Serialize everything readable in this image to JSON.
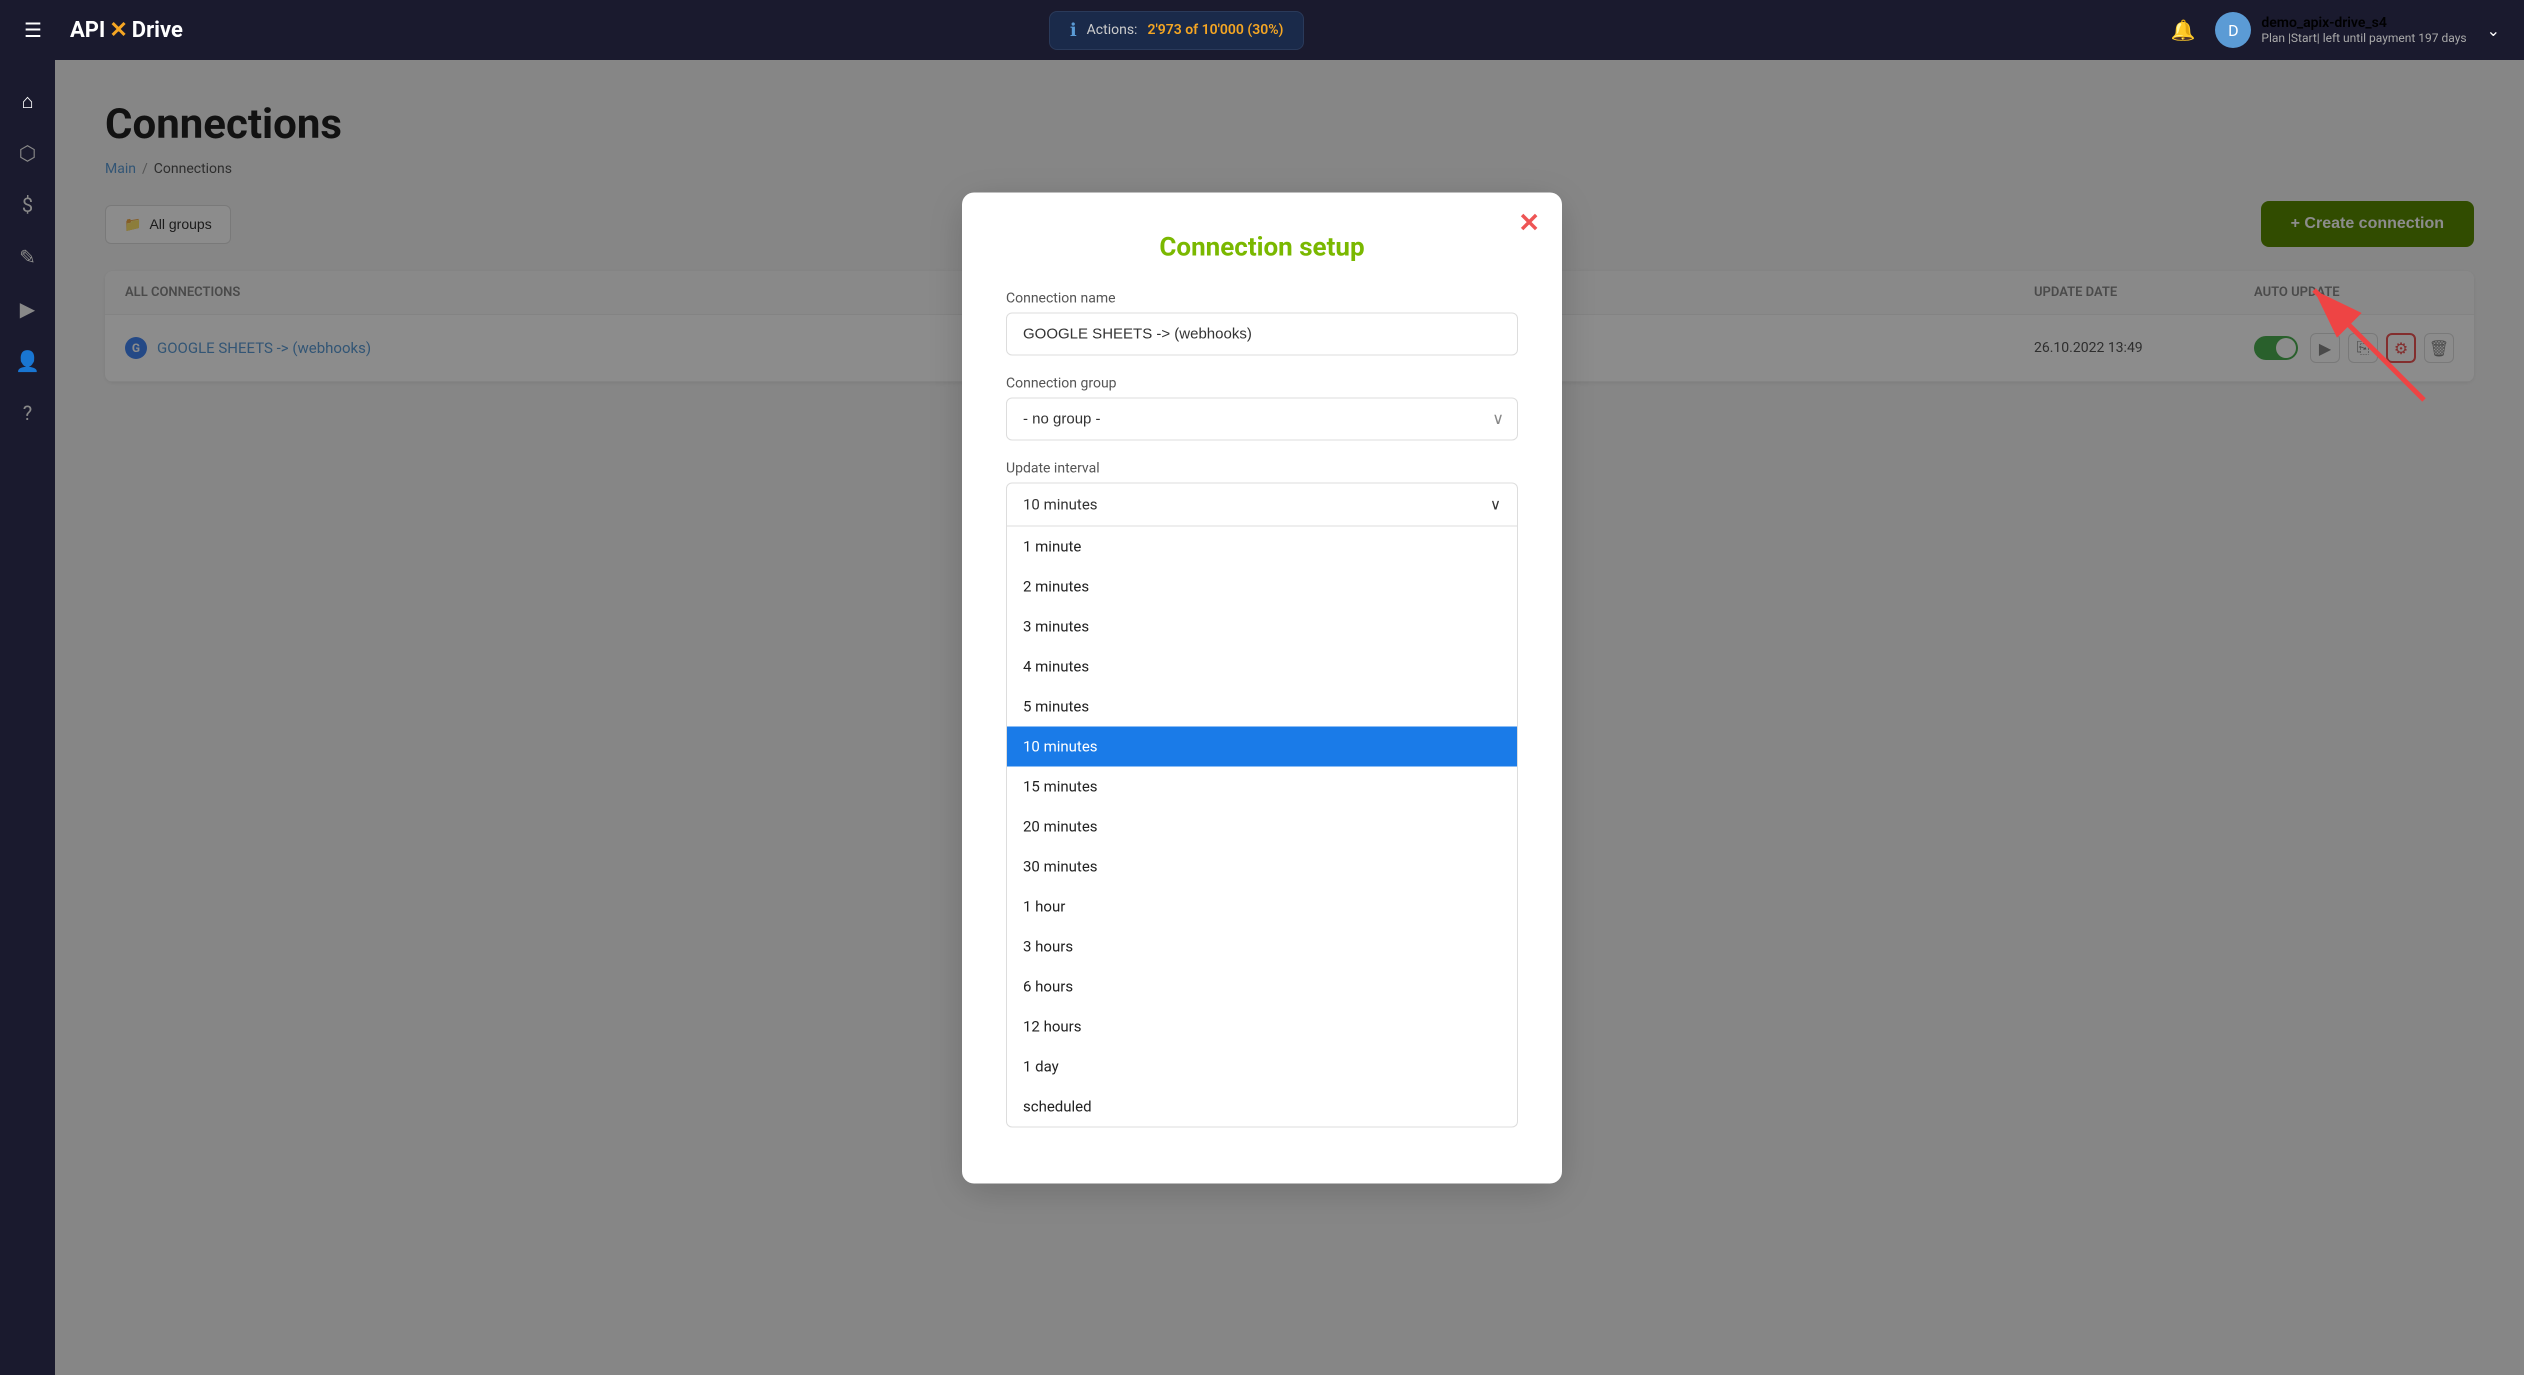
{
  "topnav": {
    "hamburger": "☰",
    "logo_api": "API",
    "logo_x": "✕",
    "logo_drive": "Drive",
    "actions_label": "Actions:",
    "actions_count": "2'973 of 10'000 (30%)",
    "user_name": "demo_apix-drive_s4",
    "user_plan": "Plan |Start| left until payment 197 days",
    "chevron": "⌄"
  },
  "sidebar": {
    "items": [
      {
        "icon": "⌂",
        "name": "home-icon"
      },
      {
        "icon": "⬡",
        "name": "connections-icon"
      },
      {
        "icon": "$",
        "name": "billing-icon"
      },
      {
        "icon": "✎",
        "name": "edit-icon"
      },
      {
        "icon": "▶",
        "name": "media-icon"
      },
      {
        "icon": "👤",
        "name": "user-icon"
      },
      {
        "icon": "?",
        "name": "help-icon"
      }
    ]
  },
  "page": {
    "title": "Connections",
    "breadcrumb_main": "Main",
    "breadcrumb_sep": "/",
    "breadcrumb_current": "Connections"
  },
  "toolbar": {
    "all_groups_label": "All groups",
    "create_connection_label": "+ Create connection"
  },
  "table": {
    "headers": [
      "ALL CONNECTIONS",
      "",
      "UPDATE DATE",
      "AUTO UPDATE"
    ],
    "row": {
      "name": "GOOGLE SHEETS -> (webhooks)",
      "update_date": "26.10.2022",
      "update_time": "13:49"
    }
  },
  "modal": {
    "close_symbol": "✕",
    "title": "Connection setup",
    "connection_name_label": "Connection name",
    "connection_name_value": "GOOGLE SHEETS -> (webhooks)",
    "connection_group_label": "Connection group",
    "connection_group_value": "- no group -",
    "update_interval_label": "Update interval",
    "update_interval_selected": "10 minutes",
    "dropdown_items": [
      {
        "value": "1 minute",
        "selected": false
      },
      {
        "value": "2 minutes",
        "selected": false
      },
      {
        "value": "3 minutes",
        "selected": false
      },
      {
        "value": "4 minutes",
        "selected": false
      },
      {
        "value": "5 minutes",
        "selected": false
      },
      {
        "value": "10 minutes",
        "selected": true
      },
      {
        "value": "15 minutes",
        "selected": false
      },
      {
        "value": "20 minutes",
        "selected": false
      },
      {
        "value": "30 minutes",
        "selected": false
      },
      {
        "value": "1 hour",
        "selected": false
      },
      {
        "value": "3 hours",
        "selected": false
      },
      {
        "value": "6 hours",
        "selected": false
      },
      {
        "value": "12 hours",
        "selected": false
      },
      {
        "value": "1 day",
        "selected": false
      },
      {
        "value": "scheduled",
        "selected": false
      }
    ]
  },
  "colors": {
    "accent_green": "#7ab800",
    "accent_blue": "#1a7be8",
    "accent_orange": "#f5a623",
    "accent_red": "#e55"
  }
}
